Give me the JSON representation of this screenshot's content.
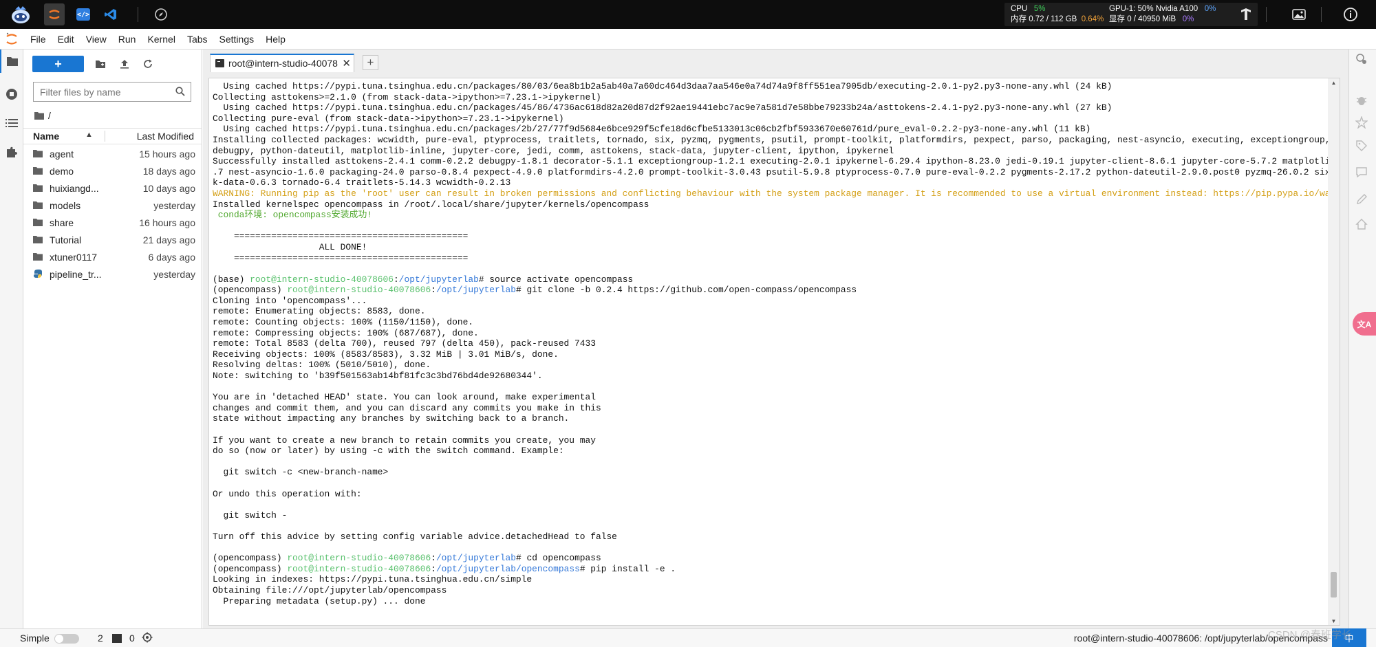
{
  "topbar": {
    "cpu_label": "CPU",
    "cpu_value": "5%",
    "mem_label": "内存 0.72 / 112 GB",
    "mem_value": "0.64%",
    "gpu_label": "GPU-1: 50% Nvidia A100",
    "gpu_value": "0%",
    "vram_label": "显存 0 / 40950 MiB",
    "vram_value": "0%"
  },
  "menu": {
    "items": [
      "File",
      "Edit",
      "View",
      "Run",
      "Kernel",
      "Tabs",
      "Settings",
      "Help"
    ]
  },
  "filebrowser": {
    "new_label": "+",
    "search_placeholder": "Filter files by name",
    "breadcrumb": "/",
    "col_name": "Name",
    "col_modified": "Last Modified",
    "files": [
      {
        "name": "agent",
        "modified": "15 hours ago",
        "type": "folder"
      },
      {
        "name": "demo",
        "modified": "18 days ago",
        "type": "folder"
      },
      {
        "name": "huixiangd...",
        "modified": "10 days ago",
        "type": "folder"
      },
      {
        "name": "models",
        "modified": "yesterday",
        "type": "folder"
      },
      {
        "name": "share",
        "modified": "16 hours ago",
        "type": "folder"
      },
      {
        "name": "Tutorial",
        "modified": "21 days ago",
        "type": "folder"
      },
      {
        "name": "xtuner0117",
        "modified": "6 days ago",
        "type": "folder"
      },
      {
        "name": "pipeline_tr...",
        "modified": "yesterday",
        "type": "python"
      }
    ]
  },
  "tabs": {
    "active_label": "root@intern-studio-40078",
    "close_glyph": "✕",
    "add_label": "+"
  },
  "terminal": {
    "lines": [
      {
        "parts": [
          {
            "t": "  Using cached https://pypi.tuna.tsinghua.edu.cn/packages/80/03/6ea8b1b2a5ab40a7a60dc464d3daa7aa546e0a74d74a9f8ff551ea7905db/executing-2.0.1-py2.py3-none-any.whl (24 kB)"
          }
        ]
      },
      {
        "parts": [
          {
            "t": "Collecting asttokens>=2.1.0 (from stack-data->ipython>=7.23.1->ipykernel)"
          }
        ]
      },
      {
        "parts": [
          {
            "t": "  Using cached https://pypi.tuna.tsinghua.edu.cn/packages/45/86/4736ac618d82a20d87d2f92ae19441ebc7ac9e7a581d7e58bbe79233b24a/asttokens-2.4.1-py2.py3-none-any.whl (27 kB)"
          }
        ]
      },
      {
        "parts": [
          {
            "t": "Collecting pure-eval (from stack-data->ipython>=7.23.1->ipykernel)"
          }
        ]
      },
      {
        "parts": [
          {
            "t": "  Using cached https://pypi.tuna.tsinghua.edu.cn/packages/2b/27/77f9d5684e6bce929f5cfe18d6cfbe5133013c06cb2fbf5933670e60761d/pure_eval-0.2.2-py3-none-any.whl (11 kB)"
          }
        ]
      },
      {
        "parts": [
          {
            "t": "Installing collected packages: wcwidth, pure-eval, ptyprocess, traitlets, tornado, six, pyzmq, pygments, psutil, prompt-toolkit, platformdirs, pexpect, parso, packaging, nest-asyncio, executing, exceptiongroup, decorator,"
          }
        ]
      },
      {
        "parts": [
          {
            "t": "debugpy, python-dateutil, matplotlib-inline, jupyter-core, jedi, comm, asttokens, stack-data, jupyter-client, ipython, ipykernel"
          }
        ]
      },
      {
        "parts": [
          {
            "t": "Successfully installed asttokens-2.4.1 comm-0.2.2 debugpy-1.8.1 decorator-5.1.1 exceptiongroup-1.2.1 executing-2.0.1 ipykernel-6.29.4 ipython-8.23.0 jedi-0.19.1 jupyter-client-8.6.1 jupyter-core-5.7.2 matplotlib-inline-0.1"
          }
        ]
      },
      {
        "parts": [
          {
            "t": ".7 nest-asyncio-1.6.0 packaging-24.0 parso-0.8.4 pexpect-4.9.0 platformdirs-4.2.0 prompt-toolkit-3.0.43 psutil-5.9.8 ptyprocess-0.7.0 pure-eval-0.2.2 pygments-2.17.2 python-dateutil-2.9.0.post0 pyzmq-26.0.2 six-1.16.0 stac"
          }
        ]
      },
      {
        "parts": [
          {
            "t": "k-data-0.6.3 tornado-6.4 traitlets-5.14.3 wcwidth-0.2.13"
          }
        ]
      },
      {
        "parts": [
          {
            "t": "WARNING: Running pip as the 'root' user can result in broken permissions and conflicting behaviour with the system package manager. It is recommended to use a virtual environment instead: https://pip.pypa.io/warnings/venv",
            "c": "w"
          }
        ]
      },
      {
        "parts": [
          {
            "t": "Installed kernelspec opencompass in /root/.local/share/jupyter/kernels/opencompass"
          }
        ]
      },
      {
        "parts": [
          {
            "t": " conda环境: opencompass安装成功!",
            "c": "gr"
          }
        ]
      },
      {
        "parts": [
          {
            "t": ""
          }
        ]
      },
      {
        "parts": [
          {
            "t": "    ============================================"
          }
        ]
      },
      {
        "parts": [
          {
            "t": "                    ALL DONE!"
          }
        ]
      },
      {
        "parts": [
          {
            "t": "    ============================================"
          }
        ]
      },
      {
        "parts": [
          {
            "t": ""
          }
        ]
      },
      {
        "parts": [
          {
            "t": "(base) "
          },
          {
            "t": "root@intern-studio-40078606",
            "c": "pb"
          },
          {
            "t": ":"
          },
          {
            "t": "/opt/jupyterlab",
            "c": "pp"
          },
          {
            "t": "# source activate opencompass"
          }
        ]
      },
      {
        "parts": [
          {
            "t": "(opencompass) "
          },
          {
            "t": "root@intern-studio-40078606",
            "c": "pb"
          },
          {
            "t": ":"
          },
          {
            "t": "/opt/jupyterlab",
            "c": "pp"
          },
          {
            "t": "# git clone -b 0.2.4 https://github.com/open-compass/opencompass"
          }
        ]
      },
      {
        "parts": [
          {
            "t": "Cloning into 'opencompass'..."
          }
        ]
      },
      {
        "parts": [
          {
            "t": "remote: Enumerating objects: 8583, done."
          }
        ]
      },
      {
        "parts": [
          {
            "t": "remote: Counting objects: 100% (1150/1150), done."
          }
        ]
      },
      {
        "parts": [
          {
            "t": "remote: Compressing objects: 100% (687/687), done."
          }
        ]
      },
      {
        "parts": [
          {
            "t": "remote: Total 8583 (delta 700), reused 797 (delta 450), pack-reused 7433"
          }
        ]
      },
      {
        "parts": [
          {
            "t": "Receiving objects: 100% (8583/8583), 3.32 MiB | 3.01 MiB/s, done."
          }
        ]
      },
      {
        "parts": [
          {
            "t": "Resolving deltas: 100% (5010/5010), done."
          }
        ]
      },
      {
        "parts": [
          {
            "t": "Note: switching to 'b39f501563ab14bf81fc3c3bd76bd4de92680344'."
          }
        ]
      },
      {
        "parts": [
          {
            "t": ""
          }
        ]
      },
      {
        "parts": [
          {
            "t": "You are in 'detached HEAD' state. You can look around, make experimental"
          }
        ]
      },
      {
        "parts": [
          {
            "t": "changes and commit them, and you can discard any commits you make in this"
          }
        ]
      },
      {
        "parts": [
          {
            "t": "state without impacting any branches by switching back to a branch."
          }
        ]
      },
      {
        "parts": [
          {
            "t": ""
          }
        ]
      },
      {
        "parts": [
          {
            "t": "If you want to create a new branch to retain commits you create, you may"
          }
        ]
      },
      {
        "parts": [
          {
            "t": "do so (now or later) by using -c with the switch command. Example:"
          }
        ]
      },
      {
        "parts": [
          {
            "t": ""
          }
        ]
      },
      {
        "parts": [
          {
            "t": "  git switch -c <new-branch-name>"
          }
        ]
      },
      {
        "parts": [
          {
            "t": ""
          }
        ]
      },
      {
        "parts": [
          {
            "t": "Or undo this operation with:"
          }
        ]
      },
      {
        "parts": [
          {
            "t": ""
          }
        ]
      },
      {
        "parts": [
          {
            "t": "  git switch -"
          }
        ]
      },
      {
        "parts": [
          {
            "t": ""
          }
        ]
      },
      {
        "parts": [
          {
            "t": "Turn off this advice by setting config variable advice.detachedHead to false"
          }
        ]
      },
      {
        "parts": [
          {
            "t": ""
          }
        ]
      },
      {
        "parts": [
          {
            "t": "(opencompass) "
          },
          {
            "t": "root@intern-studio-40078606",
            "c": "pb"
          },
          {
            "t": ":"
          },
          {
            "t": "/opt/jupyterlab",
            "c": "pp"
          },
          {
            "t": "# cd opencompass"
          }
        ]
      },
      {
        "parts": [
          {
            "t": "(opencompass) "
          },
          {
            "t": "root@intern-studio-40078606",
            "c": "pb"
          },
          {
            "t": ":"
          },
          {
            "t": "/opt/jupyterlab/opencompass",
            "c": "pp"
          },
          {
            "t": "# pip install -e ."
          }
        ]
      },
      {
        "parts": [
          {
            "t": "Looking in indexes: https://pypi.tuna.tsinghua.edu.cn/simple"
          }
        ]
      },
      {
        "parts": [
          {
            "t": "Obtaining file:///opt/jupyterlab/opencompass"
          }
        ]
      },
      {
        "parts": [
          {
            "t": "  Preparing metadata (setup.py) ... done"
          }
        ]
      }
    ]
  },
  "statusbar": {
    "mode_label": "Simple",
    "terminal_count": "2",
    "kernel_count": "0",
    "right_text": "root@intern-studio-40078606: /opt/jupyterlab/opencompass",
    "lang_badge": "中",
    "watermark": "CSDN @春班学长"
  },
  "colors": {
    "accent": "#1976d2",
    "warning": "#d4a017",
    "prompt_user": "#58c06c",
    "prompt_path": "#3478d8",
    "success_text": "#51a82f"
  }
}
